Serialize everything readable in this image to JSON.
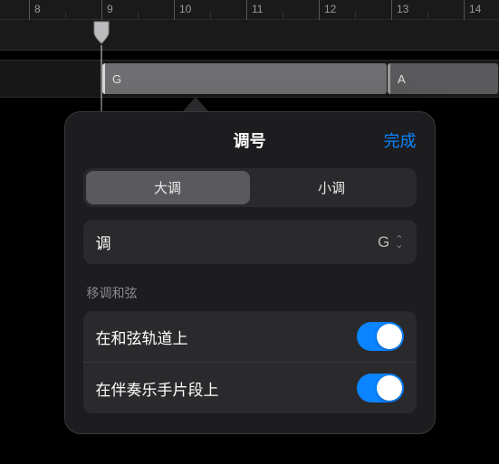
{
  "ruler": {
    "bars": [
      "8",
      "9",
      "10",
      "11",
      "12",
      "13",
      "14"
    ]
  },
  "regions": {
    "g_label": "G",
    "a_label": "A"
  },
  "popover": {
    "title": "调号",
    "done": "完成",
    "segments": {
      "major": "大调",
      "minor": "小调"
    },
    "key_label": "调",
    "key_value": "G",
    "section_label": "移调和弦",
    "toggle1_label": "在和弦轨道上",
    "toggle2_label": "在伴奏乐手片段上"
  }
}
